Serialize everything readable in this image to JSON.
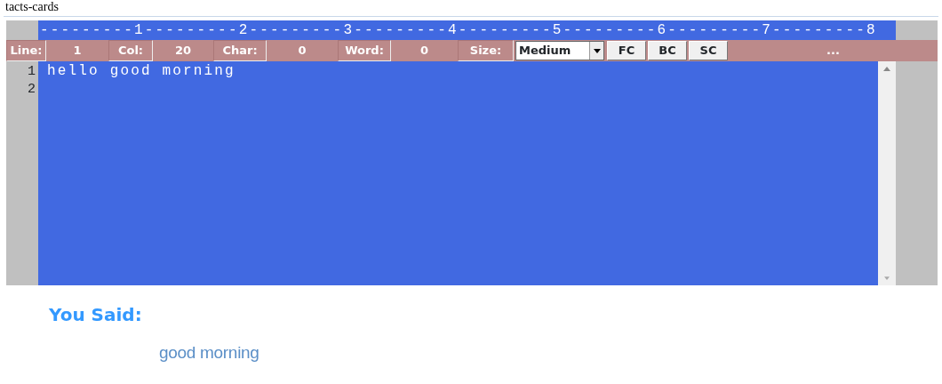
{
  "page_heading": "tacts-cards",
  "editor": {
    "ruler": "---------1---------2---------3---------4---------5---------6---------7---------8",
    "status": [
      {
        "kind": "label",
        "text": "Line:"
      },
      {
        "kind": "value",
        "text": "1"
      },
      {
        "kind": "label",
        "text": "Col:"
      },
      {
        "kind": "value",
        "text": "20"
      },
      {
        "kind": "label",
        "text": "Char:"
      },
      {
        "kind": "value",
        "text": "0"
      },
      {
        "kind": "label",
        "text": "Word:"
      },
      {
        "kind": "value",
        "text": "0"
      },
      {
        "kind": "label",
        "text": "Size:"
      },
      {
        "kind": "select",
        "text": "Medium"
      },
      {
        "kind": "button",
        "text": "FC"
      },
      {
        "kind": "button",
        "text": "BC"
      },
      {
        "kind": "button",
        "text": "SC"
      },
      {
        "kind": "more",
        "text": "..."
      }
    ],
    "line_numbers": [
      "1",
      "2"
    ],
    "text": "hello good morning"
  },
  "result": {
    "title": "You Said:",
    "text": "good morning"
  }
}
